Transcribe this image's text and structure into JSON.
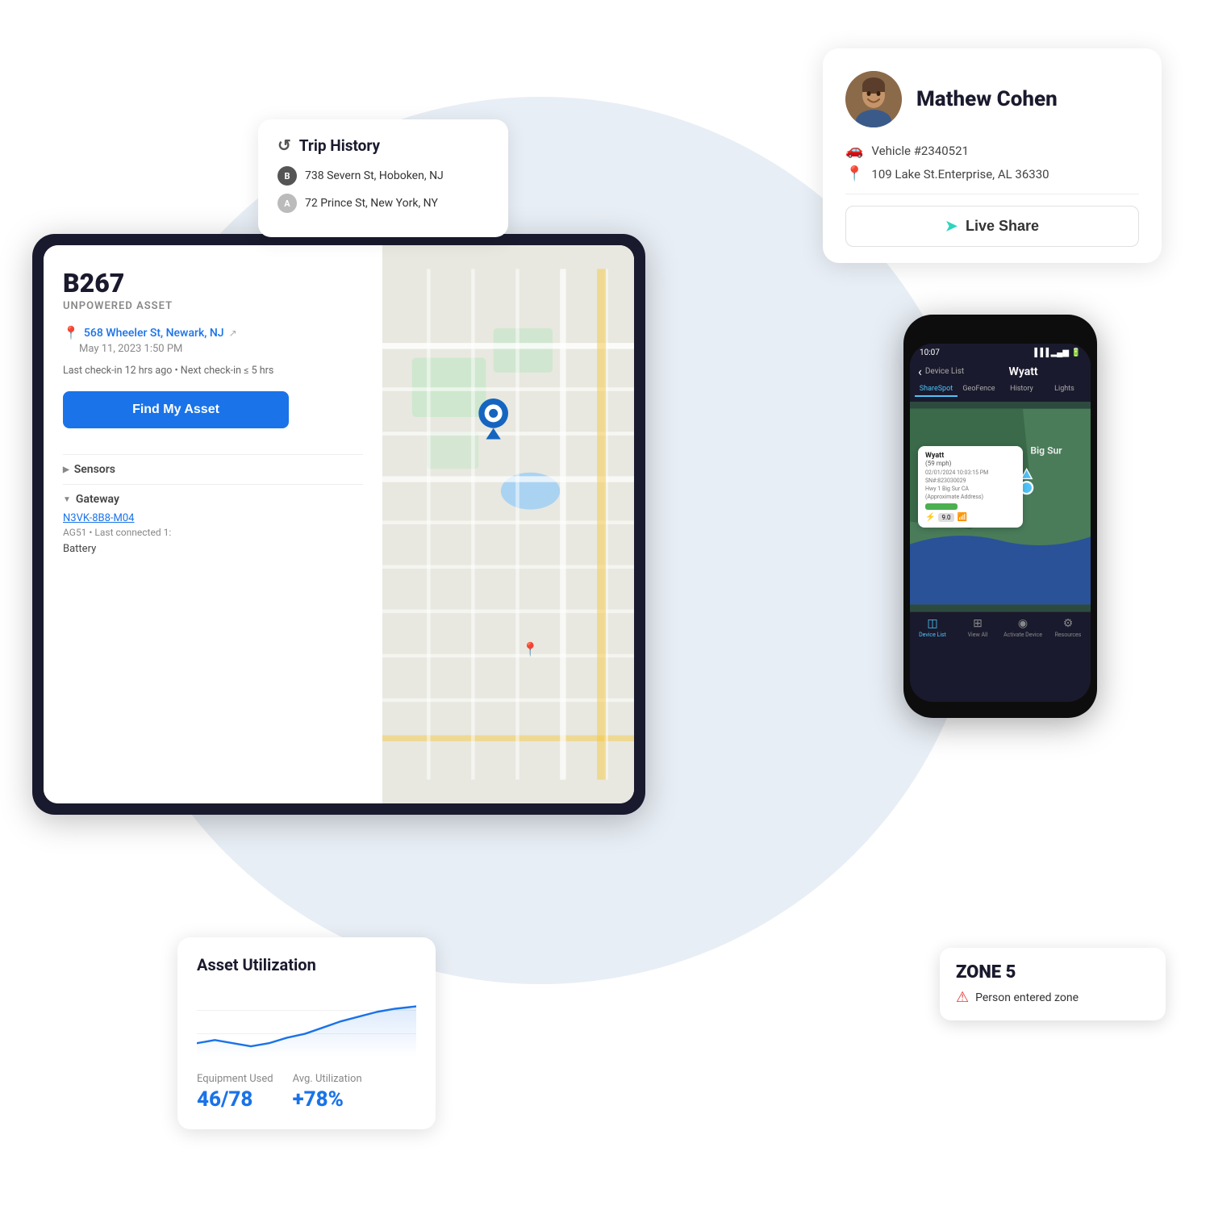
{
  "background_circle": {
    "visible": true
  },
  "trip_history": {
    "title": "Trip History",
    "stops": [
      {
        "badge": "B",
        "address": "738 Severn St, Hoboken, NJ"
      },
      {
        "badge": "A",
        "address": "72 Prince St, New York, NY"
      }
    ]
  },
  "profile": {
    "name": "Mathew Cohen",
    "vehicle": "Vehicle #2340521",
    "address": "109 Lake St.Enterprise, AL 36330",
    "live_share_label": "Live Share"
  },
  "asset": {
    "id": "B267",
    "type": "UNPOWERED ASSET",
    "location": "568 Wheeler St, Newark, NJ",
    "date": "May 11, 2023 1:50 PM",
    "checkin": "Last check-in 12 hrs ago • Next check-in ≤ 5 hrs",
    "find_my_asset_label": "Find My Asset",
    "sensors_label": "Sensors",
    "gateway_label": "Gateway",
    "gateway_id": "N3VK-8B8-M04",
    "gateway_info": "AG51 • Last connected 1:",
    "battery_label": "Battery"
  },
  "utilization": {
    "title": "Asset Utilization",
    "equipment_used_label": "Equipment Used",
    "avg_utilization_label": "Avg. Utilization",
    "equipment_used_value": "46/78",
    "avg_utilization_value": "+78%",
    "chart_data": [
      30,
      28,
      25,
      26,
      30,
      35,
      38,
      42,
      48,
      52,
      55,
      58
    ]
  },
  "phone": {
    "time": "10:07",
    "device_list_label": "Device List",
    "title": "Wyatt",
    "tabs": [
      "ShareSpot",
      "GeoFence",
      "History",
      "Lights"
    ],
    "active_tab": "ShareSpot",
    "map": {
      "label": "Big Sur",
      "popup": {
        "title": "Wyatt",
        "speed": "(59 mph)",
        "date": "02/01/2024 10:03:15 PM",
        "address": "SN#:823030029",
        "address2": "Hwy 1 Big Sur CA",
        "note": "(Approximate Address)",
        "battery": "100%"
      }
    },
    "bottom_items": [
      "Device List",
      "View All",
      "Activate Device",
      "Resources"
    ]
  },
  "zone_alert": {
    "zone_name": "ZONE 5",
    "alert_text": "Person entered zone"
  },
  "colors": {
    "accent_blue": "#1a73e8",
    "accent_teal": "#2dd4bf",
    "alert_red": "#e53935",
    "text_dark": "#1a1a2e",
    "bg_light": "#e8eef5"
  }
}
